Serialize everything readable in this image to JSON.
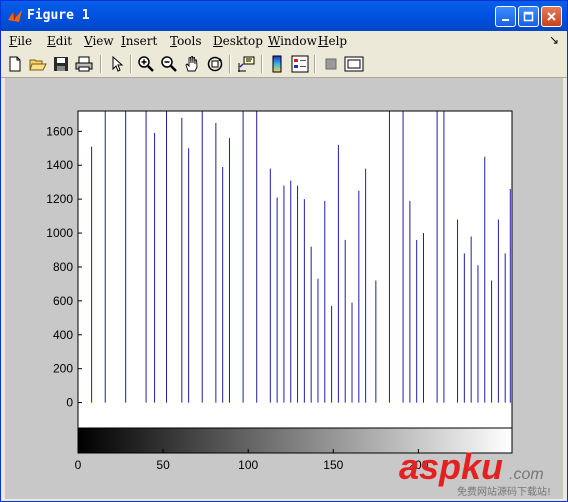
{
  "window": {
    "title": "Figure 1"
  },
  "menu": {
    "items": [
      {
        "key": "F",
        "rest": "ile"
      },
      {
        "key": "E",
        "rest": "dit"
      },
      {
        "key": "V",
        "rest": "iew"
      },
      {
        "key": "I",
        "rest": "nsert"
      },
      {
        "key": "T",
        "rest": "ools"
      },
      {
        "key": "D",
        "rest": "esktop"
      },
      {
        "key": "W",
        "rest": "indow"
      },
      {
        "key": "H",
        "rest": "elp"
      }
    ],
    "dock_arrow": "↘"
  },
  "toolbar": {
    "icons": [
      "new-figure-icon",
      "open-file-icon",
      "save-icon",
      "print-icon",
      "edit-plot-arrow-icon",
      "zoom-in-icon",
      "zoom-out-icon",
      "pan-hand-icon",
      "rotate-3d-icon",
      "data-cursor-icon",
      "insert-colorbar-icon",
      "insert-legend-icon",
      "hide-plot-tools-icon",
      "show-plot-tools-icon"
    ]
  },
  "chart_data": {
    "type": "bar",
    "style": "stem",
    "series_color": "#1f1fa0",
    "xlim": [
      0,
      255
    ],
    "ylim": [
      -150,
      1720
    ],
    "x_ticks": [
      "0",
      "50",
      "100",
      "150",
      "200"
    ],
    "y_ticks": [
      "0",
      "200",
      "400",
      "600",
      "800",
      "1000",
      "1200",
      "1400",
      "1600"
    ],
    "colorbar": "grayscale 0 to 255",
    "x": [
      0,
      8,
      16,
      28,
      40,
      45,
      52,
      61,
      65,
      73,
      81,
      85,
      89,
      97,
      105,
      113,
      117,
      121,
      125,
      129,
      133,
      137,
      141,
      145,
      149,
      153,
      157,
      161,
      165,
      169,
      175,
      183,
      191,
      195,
      199,
      203,
      211,
      215,
      223,
      227,
      231,
      235,
      239,
      243,
      247,
      251,
      254
    ],
    "values": [
      1720,
      1510,
      1720,
      1720,
      1720,
      1590,
      1720,
      1680,
      1500,
      1720,
      1650,
      1390,
      1560,
      1720,
      1720,
      1380,
      1210,
      1280,
      1310,
      1280,
      1200,
      920,
      730,
      1190,
      570,
      1520,
      960,
      590,
      1250,
      1380,
      720,
      1720,
      1720,
      1190,
      960,
      1000,
      1720,
      1720,
      1080,
      880,
      980,
      810,
      1450,
      720,
      1080,
      880,
      1260
    ]
  },
  "watermark": {
    "main": "aspku",
    "suffix": ".com",
    "subtitle": "免费网站源码下载站!"
  }
}
